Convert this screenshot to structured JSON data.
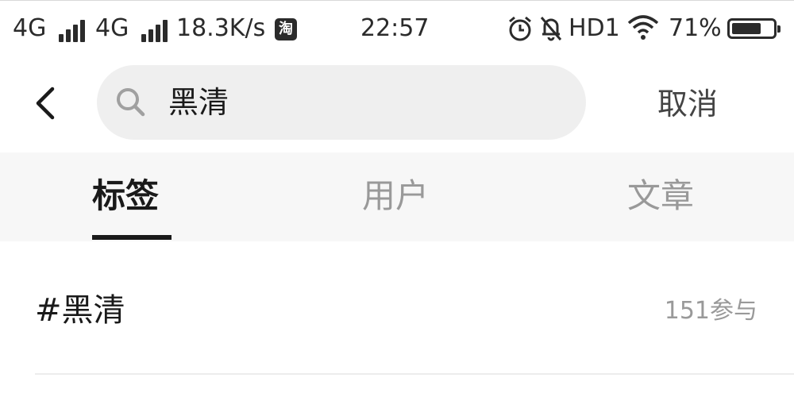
{
  "status_bar": {
    "network1": "4G",
    "network2": "4G",
    "speed": "18.3K/s",
    "app_badge": "淘",
    "time": "22:57",
    "hd": "HD1",
    "battery_percent": "71%",
    "battery_level": 0.71
  },
  "search": {
    "query": "黑清",
    "cancel_label": "取消"
  },
  "tabs": [
    {
      "label": "标签",
      "active": true
    },
    {
      "label": "用户",
      "active": false
    },
    {
      "label": "文章",
      "active": false
    }
  ],
  "results": [
    {
      "tag": "#黑清",
      "count": "151参与"
    }
  ]
}
